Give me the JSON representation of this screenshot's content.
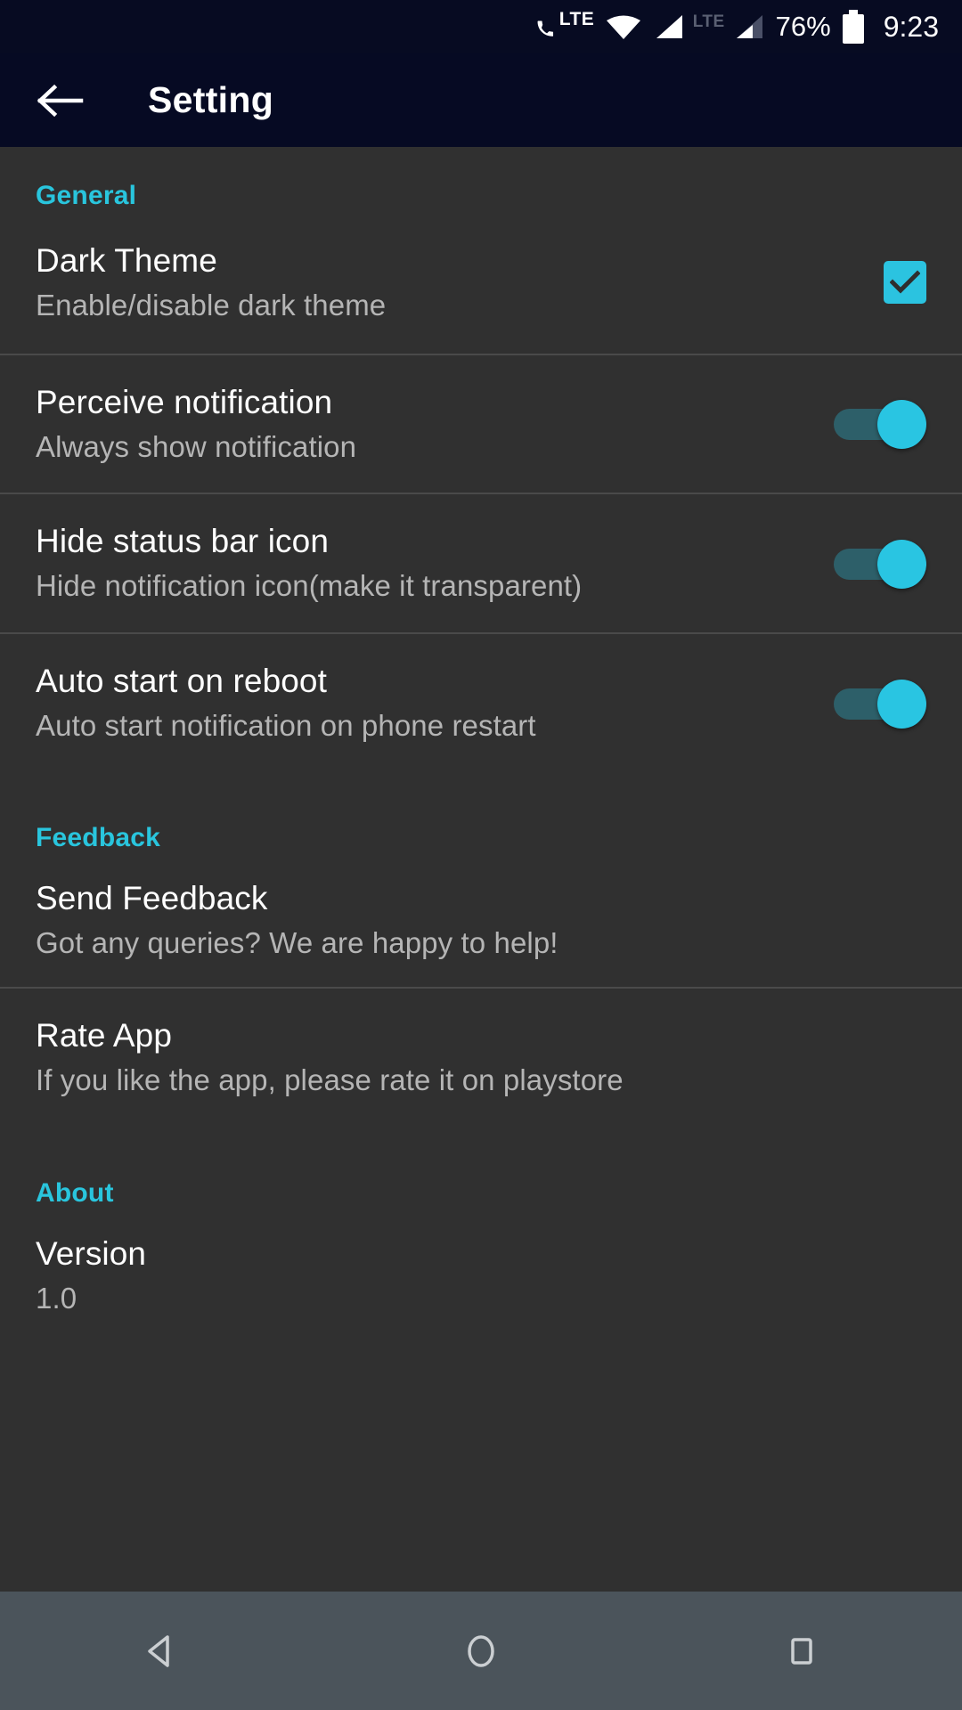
{
  "status_bar": {
    "volte_label": "LTE",
    "network_label": "LTE",
    "battery_percent": "76%",
    "time": "9:23",
    "icons": [
      "volte-icon",
      "wifi-icon",
      "signal-icon",
      "signal-icon-secondary",
      "battery-icon"
    ]
  },
  "app_bar": {
    "back_icon": "arrow-left-icon",
    "title": "Setting"
  },
  "colors": {
    "accent": "#29C5DD",
    "toggle_on_thumb": "#29C5E2",
    "toggle_on_track": "#2D5F69",
    "checkbox_on": "#2BC3E0",
    "background": "#303030",
    "appbar": "#060A23",
    "navbar": "#4B545B",
    "title_text": "#FFFFFF",
    "subtitle_text": "#B5B5B5",
    "divider": "#4A4A4A"
  },
  "sections": [
    {
      "header": "General",
      "rows": [
        {
          "title": "Dark Theme",
          "subtitle": "Enable/disable dark theme",
          "control": "checkbox",
          "checked": true,
          "name": "dark-theme"
        },
        {
          "title": "Perceive notification",
          "subtitle": "Always show notification",
          "control": "toggle",
          "checked": true,
          "name": "perceive-notification"
        },
        {
          "title": "Hide status bar icon",
          "subtitle": "Hide notification icon(make it transparent)",
          "control": "toggle",
          "checked": true,
          "name": "hide-status-bar-icon"
        },
        {
          "title": "Auto start on reboot",
          "subtitle": "Auto start notification on phone restart",
          "control": "toggle",
          "checked": true,
          "name": "auto-start-on-reboot"
        }
      ]
    },
    {
      "header": "Feedback",
      "rows": [
        {
          "title": "Send Feedback",
          "subtitle": "Got any queries? We are happy to help!",
          "control": "none",
          "name": "send-feedback"
        },
        {
          "title": "Rate App",
          "subtitle": "If you like the app, please rate it on playstore",
          "control": "none",
          "name": "rate-app"
        }
      ]
    },
    {
      "header": "About",
      "rows": [
        {
          "title": "Version",
          "subtitle": "1.0",
          "control": "none",
          "name": "version"
        }
      ]
    }
  ],
  "nav_bar": {
    "back": "back-triangle-icon",
    "home": "home-circle-icon",
    "recents": "recents-square-icon"
  }
}
